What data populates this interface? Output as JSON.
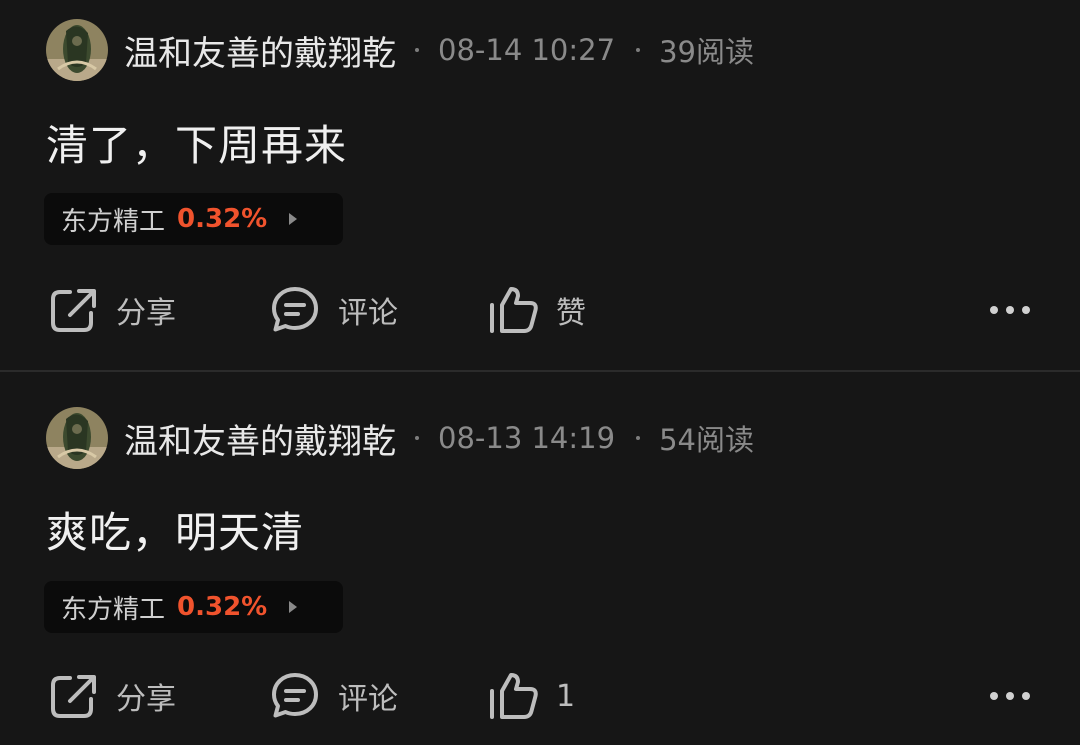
{
  "posts": [
    {
      "author": "温和友善的戴翔乾",
      "timestamp": "08-14 10:27",
      "reads": "39阅读",
      "content": "清了，下周再来",
      "stock": {
        "name": "东方精工",
        "change": "0.32%"
      },
      "actions": {
        "share": "分享",
        "comment": "评论",
        "like": "赞"
      }
    },
    {
      "author": "温和友善的戴翔乾",
      "timestamp": "08-13 14:19",
      "reads": "54阅读",
      "content": "爽吃，明天清",
      "stock": {
        "name": "东方精工",
        "change": "0.32%"
      },
      "actions": {
        "share": "分享",
        "comment": "评论",
        "like": "1"
      }
    }
  ],
  "icons": {
    "share": "share-icon",
    "comment": "comment-icon",
    "like": "thumbs-up-icon",
    "more": "more-dots-icon"
  },
  "colors": {
    "background": "#161616",
    "stock_up": "#f0532d",
    "icon": "#bdbdbd"
  }
}
